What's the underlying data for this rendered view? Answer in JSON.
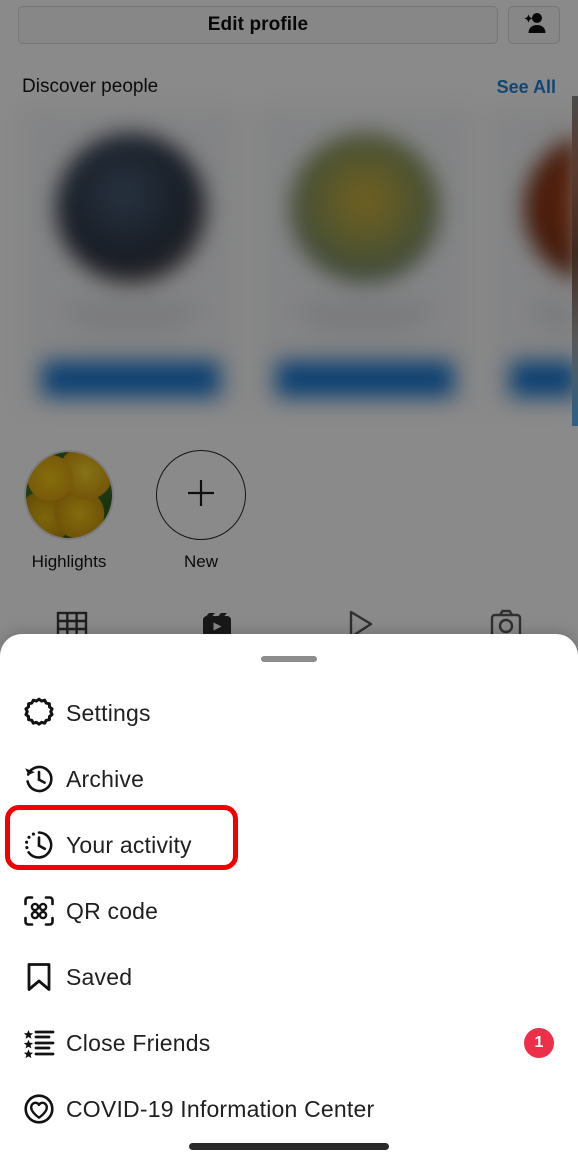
{
  "profile": {
    "edit_profile_label": "Edit profile",
    "add_person_icon": "person-add-icon",
    "discover": {
      "title": "Discover people",
      "see_all_label": "See All",
      "cards": [
        {
          "avatar_color": "#2c3645"
        },
        {
          "avatar_color": "#8f9a5a"
        },
        {
          "avatar_color": "#7e2f12"
        }
      ]
    },
    "highlights": [
      {
        "label": "Highlights",
        "icon": "story-highlight-thumb"
      },
      {
        "label": "New",
        "icon": "plus-icon"
      }
    ],
    "tabs": [
      {
        "name": "grid-tab",
        "icon": "grid-icon"
      },
      {
        "name": "reels-tab",
        "icon": "reels-icon"
      },
      {
        "name": "igtv-tab",
        "icon": "igtv-play-icon"
      },
      {
        "name": "tagged-tab",
        "icon": "tagged-person-icon"
      }
    ]
  },
  "sheet": {
    "handle": "drag-handle",
    "items": [
      {
        "label": "Settings",
        "icon": "gear-icon",
        "badge": ""
      },
      {
        "label": "Archive",
        "icon": "archive-clock-icon",
        "badge": ""
      },
      {
        "label": "Your activity",
        "icon": "activity-clock-icon",
        "badge": "",
        "highlighted": true
      },
      {
        "label": "QR code",
        "icon": "qr-code-icon",
        "badge": ""
      },
      {
        "label": "Saved",
        "icon": "bookmark-icon",
        "badge": ""
      },
      {
        "label": "Close Friends",
        "icon": "star-list-icon",
        "badge": "1"
      },
      {
        "label": "COVID-19 Information Center",
        "icon": "covid-heart-icon",
        "badge": ""
      }
    ]
  },
  "colors": {
    "accent_blue": "#1d80d8",
    "badge_red": "#ed2f4a",
    "highlight_red": "#f20000",
    "follow_blue": "#1877d2"
  },
  "system": {
    "gesture_bar": "home-indicator"
  }
}
